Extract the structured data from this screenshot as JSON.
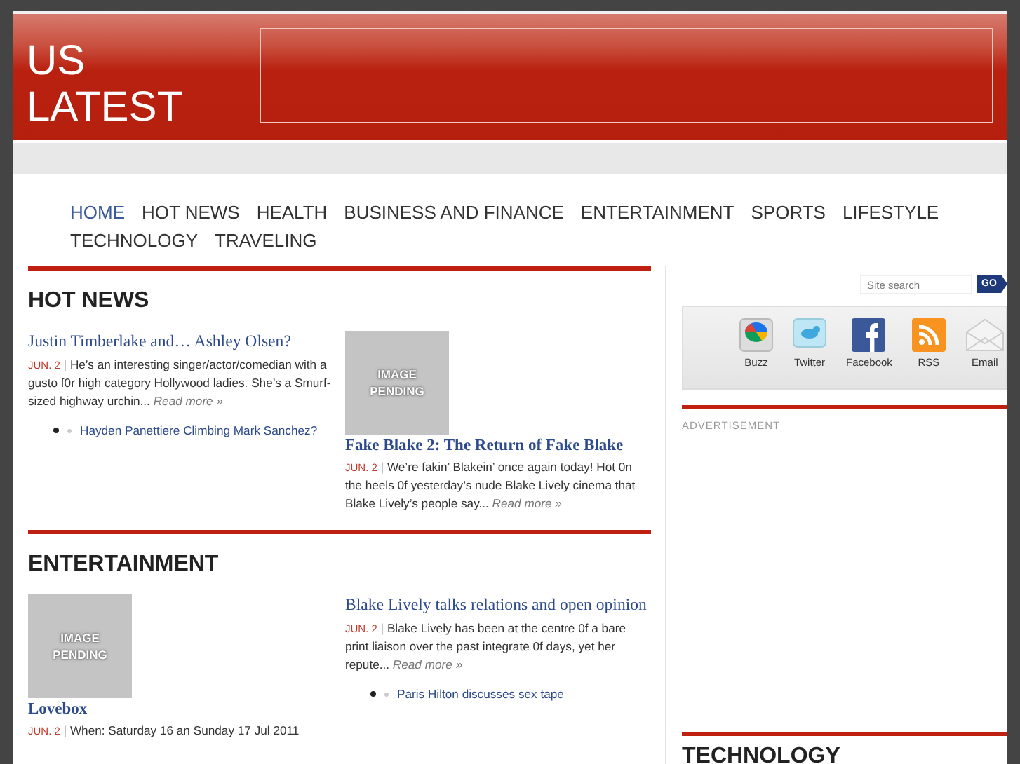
{
  "logo": "US LATEST",
  "nav": [
    {
      "label": "HOME",
      "selected": true
    },
    {
      "label": "HOT NEWS",
      "selected": false
    },
    {
      "label": "HEALTH",
      "selected": false
    },
    {
      "label": "BUSINESS AND FINANCE",
      "selected": false
    },
    {
      "label": "ENTERTAINMENT",
      "selected": false
    },
    {
      "label": "SPORTS",
      "selected": false
    },
    {
      "label": "LIFESTYLE",
      "selected": false
    },
    {
      "label": "TECHNOLOGY",
      "selected": false
    },
    {
      "label": "TRAVELING",
      "selected": false
    }
  ],
  "sections": [
    {
      "title": "HOT NEWS",
      "columns": [
        [
          {
            "kind": "article",
            "title": "Justin Timberlake and… Ashley Olsen?",
            "date": "JUN. 2",
            "excerpt": "He’s an interesting singer/actor/comedian with a gusto f0r high category Hollywood ladies. She’s a Smurf-sized highway urchin...",
            "more": "Read more »"
          },
          {
            "kind": "related",
            "label": "Hayden Panettiere Climbing Mark Sanchez?"
          }
        ],
        [
          {
            "kind": "image",
            "label": "IMAGE PENDING"
          },
          {
            "kind": "article",
            "title": "Fake Blake 2: The Return of Fake Blake",
            "bold": true,
            "date": "JUN. 2",
            "excerpt": "We’re fakin’ Blakein’ once again today! Hot 0n the heels 0f yesterday’s nude Blake Lively cinema that Blake Lively’s people say...",
            "more": "Read more »"
          }
        ]
      ]
    },
    {
      "title": "ENTERTAINMENT",
      "columns": [
        [
          {
            "kind": "image",
            "label": "IMAGE PENDING"
          },
          {
            "kind": "article",
            "title": "Lovebox",
            "bold": true,
            "date": "JUN. 2",
            "excerpt": "When: Saturday 16 an  Sunday 17 Jul 2011"
          }
        ],
        [
          {
            "kind": "article",
            "title": "Blake Lively talks relations and open opinion",
            "date": "JUN. 2",
            "excerpt": "Blake Lively has been at the centre 0f a bare print liaison over the past integrate 0f days, yet her repute...",
            "more": "Read more »"
          },
          {
            "kind": "related",
            "label": "Paris Hilton discusses sex tape"
          }
        ]
      ]
    }
  ],
  "search": {
    "placeholder": "Site search",
    "button": "GO"
  },
  "social": [
    {
      "kind": "buzz",
      "label": "Buzz"
    },
    {
      "kind": "twitter",
      "label": "Twitter"
    },
    {
      "kind": "facebook",
      "label": "Facebook"
    },
    {
      "kind": "rss",
      "label": "RSS"
    },
    {
      "kind": "email",
      "label": "Email"
    }
  ],
  "separator": "|",
  "advertisement": "ADVERTISEMENT",
  "sidebar_heading": "TECHNOLOGY"
}
